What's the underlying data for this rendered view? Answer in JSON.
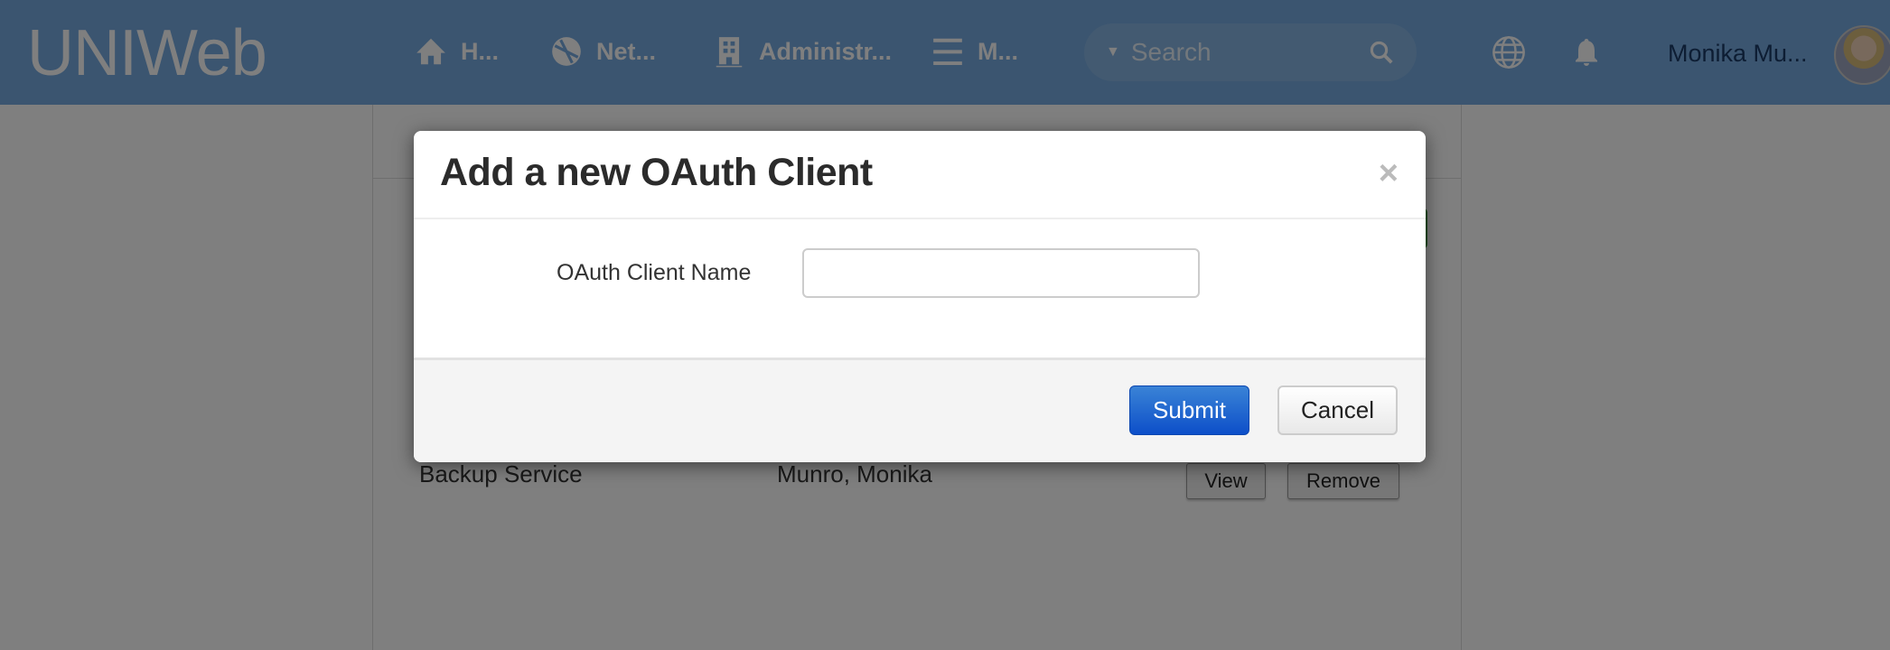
{
  "nav": {
    "logo": "UNIWeb",
    "items": [
      {
        "label": "H...",
        "icon": "home-icon"
      },
      {
        "label": "Net...",
        "icon": "network-icon"
      },
      {
        "label": "Administr...",
        "icon": "building-icon"
      },
      {
        "label": "M...",
        "icon": "menu-icon"
      }
    ],
    "search_placeholder": "Search",
    "user_name": "Monika Mu..."
  },
  "background": {
    "row": {
      "name": "Backup Service",
      "owner": "Munro, Monika",
      "view": "View",
      "remove": "Remove"
    }
  },
  "modal": {
    "title": "Add a new OAuth Client",
    "close": "×",
    "field_label": "OAuth Client Name",
    "field_value": "",
    "submit": "Submit",
    "cancel": "Cancel"
  }
}
